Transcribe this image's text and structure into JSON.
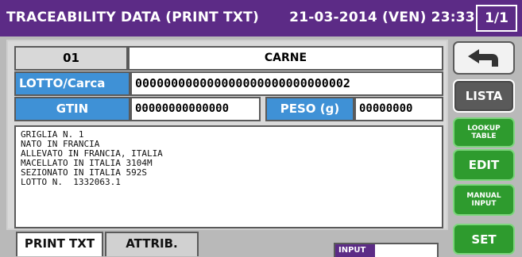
{
  "titlebar": {
    "title": "TRACEABILITY DATA (PRINT TXT)",
    "datetime": "21-03-2014 (VEN) 23:33",
    "page": "1/1"
  },
  "form": {
    "code": "01",
    "name": "CARNE",
    "lotto_label": "LOTTO/Carca",
    "lotto_value": "000000000000000000000000000002",
    "gtin_label": "GTIN",
    "gtin_value": "00000000000000",
    "peso_label": "PESO (g)",
    "peso_value": "00000000"
  },
  "print_text": {
    "lines": [
      "GRIGLIA N. 1",
      "NATO IN FRANCIA",
      "ALLEVATO IN FRANCIA, ITALIA",
      "MACELLATO IN ITALIA 3104M",
      "SEZIONATO IN ITALIA 592S",
      "LOTTO N.  1332063.1"
    ]
  },
  "sidebar": {
    "back_icon": "back-arrow-icon",
    "lista": "LISTA",
    "lookup_line1": "LOOKUP",
    "lookup_line2": "TABLE",
    "edit": "EDIT",
    "manual_line1": "MANUAL",
    "manual_line2": "INPUT",
    "set": "SET"
  },
  "tabs": {
    "print_txt": "PRINT TXT",
    "attrib": "ATTRIB."
  },
  "input": {
    "label": "INPUT",
    "value": ""
  },
  "colors": {
    "title_bg": "#5c2b86",
    "accent_blue": "#3f91d6",
    "button_green": "#2f9a2f",
    "button_dark": "#4a4a4a"
  }
}
